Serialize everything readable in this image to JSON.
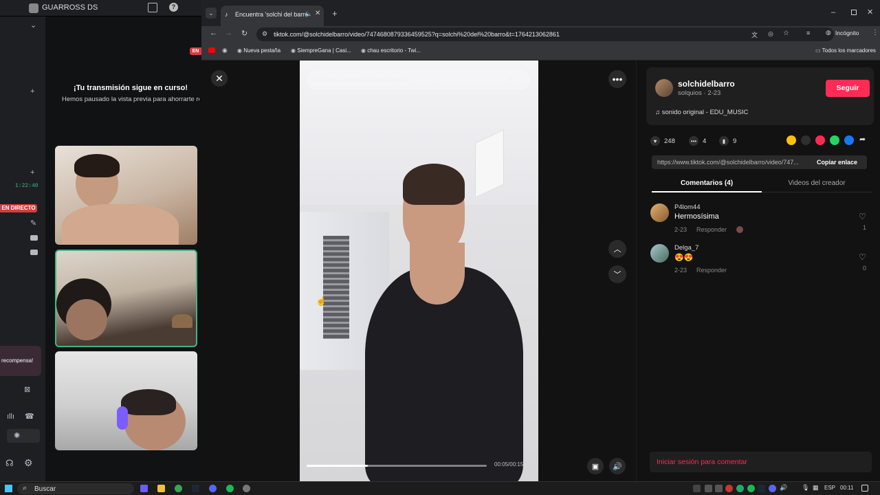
{
  "discord": {
    "server_name": "GUARROSS DS",
    "stream_heading": "¡Tu transmisión sigue en curso!",
    "stream_sub": "Hemos pausado la vista previa para ahorrarte re",
    "live_badge": "EN DIRECTO",
    "timer": "1:22:40",
    "reward_text": "recompensa!",
    "en_badge": "EN"
  },
  "browser": {
    "tab_title": "Encuentra 'solchi del barro",
    "url": "tiktok.com/@solchidelbarro/video/7474680879336459525?q=solchi%20del%20barro&t=1764213062861",
    "incognito_label": "Incógnito",
    "bookmarks": [
      {
        "label": "Nueva pestaña"
      },
      {
        "label": "SiempreGana | Casi..."
      },
      {
        "label": "chau escritorio - Twi..."
      }
    ],
    "all_bookmarks": "Todos los marcadores"
  },
  "tiktok": {
    "search_placeholder": "Buscar contenido relacionado",
    "video_time": "00:05/00:15",
    "progress": 0.34,
    "username": "solchidelbarro",
    "subline": "solquios · 2-23",
    "follow_label": "Seguir",
    "sound": "sonido original - EDU_MUSIC",
    "likes": "248",
    "comments_count": "4",
    "saves": "9",
    "link": "https://www.tiktok.com/@solchidelbarro/video/747...",
    "copy_label": "Copiar enlace",
    "tab_comments": "Comentarios (4)",
    "tab_videos": "Videos del creador",
    "comments": [
      {
        "name": "P4lom44",
        "text": "Hermosísima",
        "date": "2-23",
        "reply": "Responder",
        "likes": "1"
      },
      {
        "name": "Delga_7",
        "text": "😍😍",
        "date": "2-23",
        "reply": "Responder",
        "likes": "0"
      }
    ],
    "login_prompt": "Iniciar sesión para comentar"
  },
  "taskbar": {
    "search": "Buscar",
    "lang": "ESP",
    "time": "00:11"
  }
}
